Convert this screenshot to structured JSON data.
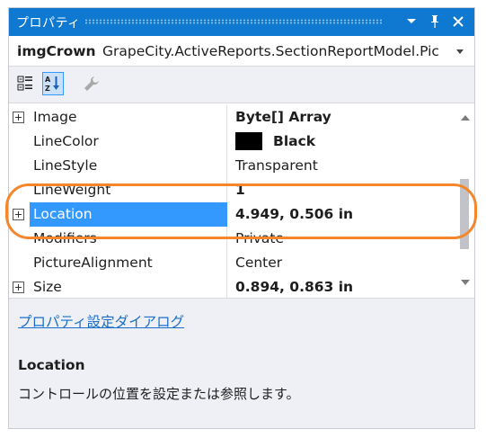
{
  "window": {
    "title": "プロパティ",
    "title_color": "#0f79d1",
    "buttons": [
      {
        "name": "dropdown-icon"
      },
      {
        "name": "pin-icon"
      },
      {
        "name": "close-icon"
      }
    ]
  },
  "object_selector": {
    "name": "imgCrown",
    "type": "GrapeCity.ActiveReports.SectionReportModel.Pic"
  },
  "toolbar": {
    "buttons": [
      {
        "name": "categorized-icon",
        "active": false
      },
      {
        "name": "alphabetical-icon",
        "active": true
      },
      {
        "name": "property-pages-icon",
        "active": false
      }
    ]
  },
  "properties": {
    "rows": [
      {
        "name": "Image",
        "value": "Byte[] Array",
        "bold": true,
        "expandable": true
      },
      {
        "name": "LineColor",
        "value": "Black",
        "bold": true,
        "swatch": "#000000"
      },
      {
        "name": "LineStyle",
        "value": "Transparent",
        "bold": false
      },
      {
        "name": "LineWeight",
        "value": "1",
        "bold": true
      },
      {
        "name": "Location",
        "value": "4.949, 0.506 in",
        "bold": true,
        "expandable": true,
        "selected": true
      },
      {
        "name": "Modifiers",
        "value": "Private",
        "bold": false
      },
      {
        "name": "PictureAlignment",
        "value": "Center",
        "bold": false
      },
      {
        "name": "Size",
        "value": "0.894, 0.863 in",
        "bold": true,
        "expandable": true
      }
    ],
    "selection_color": "#3399ff"
  },
  "commands": {
    "link": "プロパティ設定ダイアログ"
  },
  "description": {
    "title": "Location",
    "text": "コントロールの位置を設定または参照します。"
  },
  "annotation": {
    "color": "#f5862c"
  }
}
